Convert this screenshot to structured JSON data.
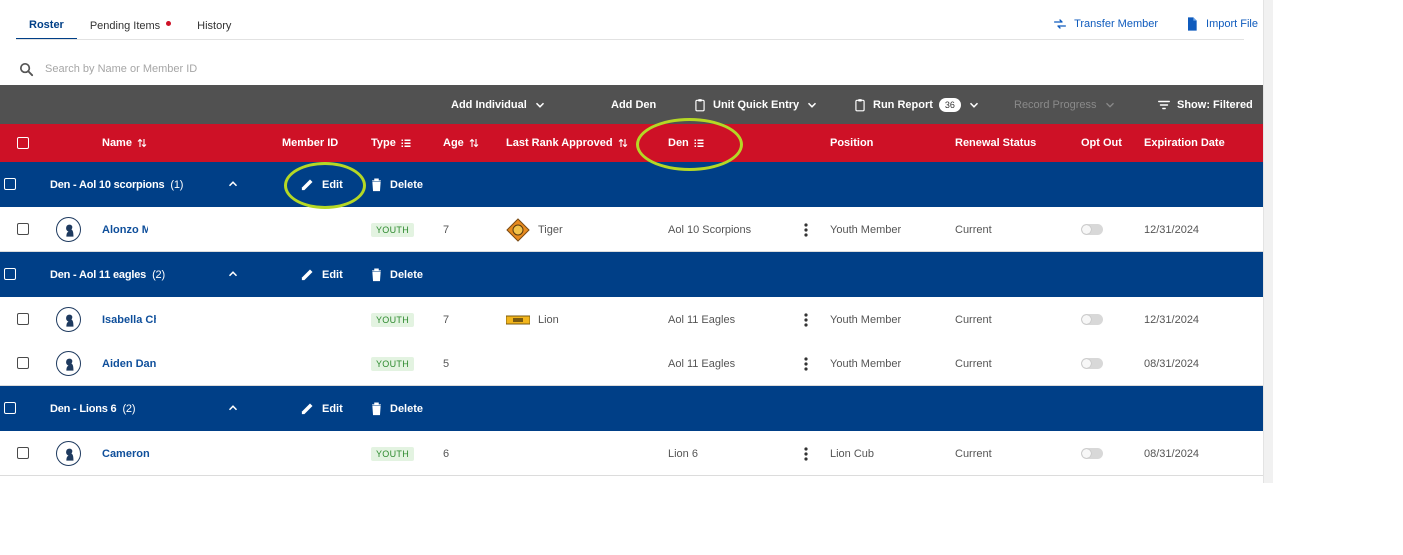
{
  "tabs": [
    {
      "label": "Roster",
      "active": true
    },
    {
      "label": "Pending Items",
      "active": false,
      "has_dot": true
    },
    {
      "label": "History",
      "active": false
    }
  ],
  "top_actions": {
    "transfer": "Transfer Member",
    "import": "Import File"
  },
  "search": {
    "placeholder": "Search by Name or Member ID"
  },
  "toolbar": {
    "add_individual": "Add Individual",
    "add_den": "Add Den",
    "unit_quick_entry": "Unit Quick Entry",
    "run_report": "Run Report",
    "report_count": "36",
    "record_progress": "Record Progress",
    "show_filtered": "Show: Filtered"
  },
  "columns": {
    "name": "Name",
    "member_id": "Member ID",
    "type": "Type",
    "age": "Age",
    "last_rank": "Last Rank Approved",
    "den": "Den",
    "position": "Position",
    "renewal": "Renewal Status",
    "opt_out": "Opt Out",
    "expiration": "Expiration Date"
  },
  "group_actions": {
    "edit": "Edit",
    "delete": "Delete"
  },
  "groups": [
    {
      "title": "Den - Aol 10 scorpions",
      "count": "(1)",
      "members": [
        {
          "name": "Alonzo M",
          "type": "YOUTH",
          "age": "7",
          "rank": "Tiger",
          "rank_badge": "tiger",
          "den": "Aol 10 Scorpions",
          "position": "Youth Member",
          "renewal": "Current",
          "expiration": "12/31/2024"
        }
      ]
    },
    {
      "title": "Den - Aol 11 eagles",
      "count": "(2)",
      "members": [
        {
          "name": "Isabella Ch",
          "type": "YOUTH",
          "age": "7",
          "rank": "Lion",
          "rank_badge": "lion",
          "den": "Aol 11 Eagles",
          "position": "Youth Member",
          "renewal": "Current",
          "expiration": "12/31/2024"
        },
        {
          "name": "Aiden Dani",
          "type": "YOUTH",
          "age": "5",
          "rank": "",
          "rank_badge": "",
          "den": "Aol 11 Eagles",
          "position": "Youth Member",
          "renewal": "Current",
          "expiration": "08/31/2024"
        }
      ]
    },
    {
      "title": "Den - Lions 6",
      "count": "(2)",
      "members": [
        {
          "name": "Cameron",
          "type": "YOUTH",
          "age": "6",
          "rank": "",
          "rank_badge": "",
          "den": "Lion 6",
          "position": "Lion Cub",
          "renewal": "Current",
          "expiration": "08/31/2024"
        }
      ]
    }
  ],
  "colors": {
    "header_red": "#ce1126",
    "group_blue": "#003f87",
    "toolbar_gray": "#515151",
    "link_blue": "#0f5bbd",
    "highlight_ring": "#b5d825"
  }
}
